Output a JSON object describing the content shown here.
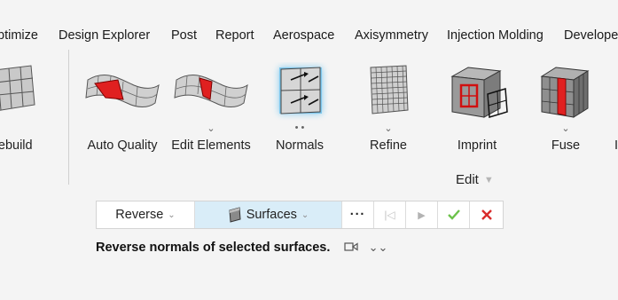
{
  "menu": {
    "items": [
      "ptimize",
      "Design Explorer",
      "Post",
      "Report",
      "Aerospace",
      "Axisymmetry",
      "Injection Molding",
      "Develope"
    ]
  },
  "ribbon": {
    "tools": [
      {
        "label": "Rebuild",
        "icon": "rebuild-mesh-icon"
      },
      {
        "label": "Auto Quality",
        "icon": "auto-quality-icon"
      },
      {
        "label": "Edit Elements",
        "icon": "edit-elements-icon",
        "sub": "⌄"
      },
      {
        "label": "Normals",
        "icon": "normals-icon",
        "sub": "• •"
      },
      {
        "label": "Refine",
        "icon": "refine-icon",
        "sub": "⌄"
      },
      {
        "label": "Imprint",
        "icon": "imprint-icon"
      },
      {
        "label": "Fuse",
        "icon": "fuse-icon",
        "sub": "⌄"
      }
    ],
    "edit_group_label": "Edit"
  },
  "toolbar": {
    "reverse_label": "Reverse",
    "surfaces_label": "Surfaces",
    "more_label": "···",
    "first_icon": "skip-back-icon",
    "play_icon": "play-icon",
    "confirm_icon": "check-icon",
    "cancel_icon": "close-icon"
  },
  "status": {
    "message": "Reverse normals of selected surfaces."
  },
  "colors": {
    "accent_blue": "#1aa3e8",
    "surfaces_bg": "#d9edf8",
    "confirm_green": "#6cc24a",
    "cancel_red": "#d92b2b",
    "highlight_red": "#e02020"
  }
}
